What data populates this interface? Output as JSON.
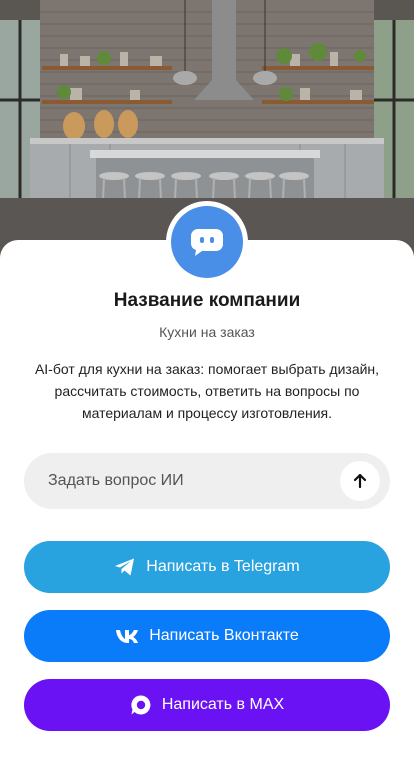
{
  "hero": {
    "image": "kitchen-interior-photo"
  },
  "company": {
    "avatar_icon": "chat-bot-icon",
    "name": "Название компании",
    "subtitle": "Кухни на заказ",
    "description": "AI-бот для кухни на заказ: помогает выбрать дизайн, рассчитать стоимость, ответить на вопросы по материалам и процессу изготовления."
  },
  "ask": {
    "placeholder": "Задать вопрос ИИ",
    "send_icon": "arrow-up-icon"
  },
  "buttons": {
    "telegram": {
      "label": "Написать в Telegram",
      "icon": "telegram-icon",
      "color": "#29a3e0"
    },
    "vk": {
      "label": "Написать Вконтакте",
      "icon": "vk-icon",
      "color": "#0b7cf9"
    },
    "max": {
      "label": "Написать в MAX",
      "icon": "max-icon",
      "color": "#6b12f5"
    }
  },
  "colors": {
    "avatar": "#4a8fe7",
    "input_bg": "#efefef"
  }
}
